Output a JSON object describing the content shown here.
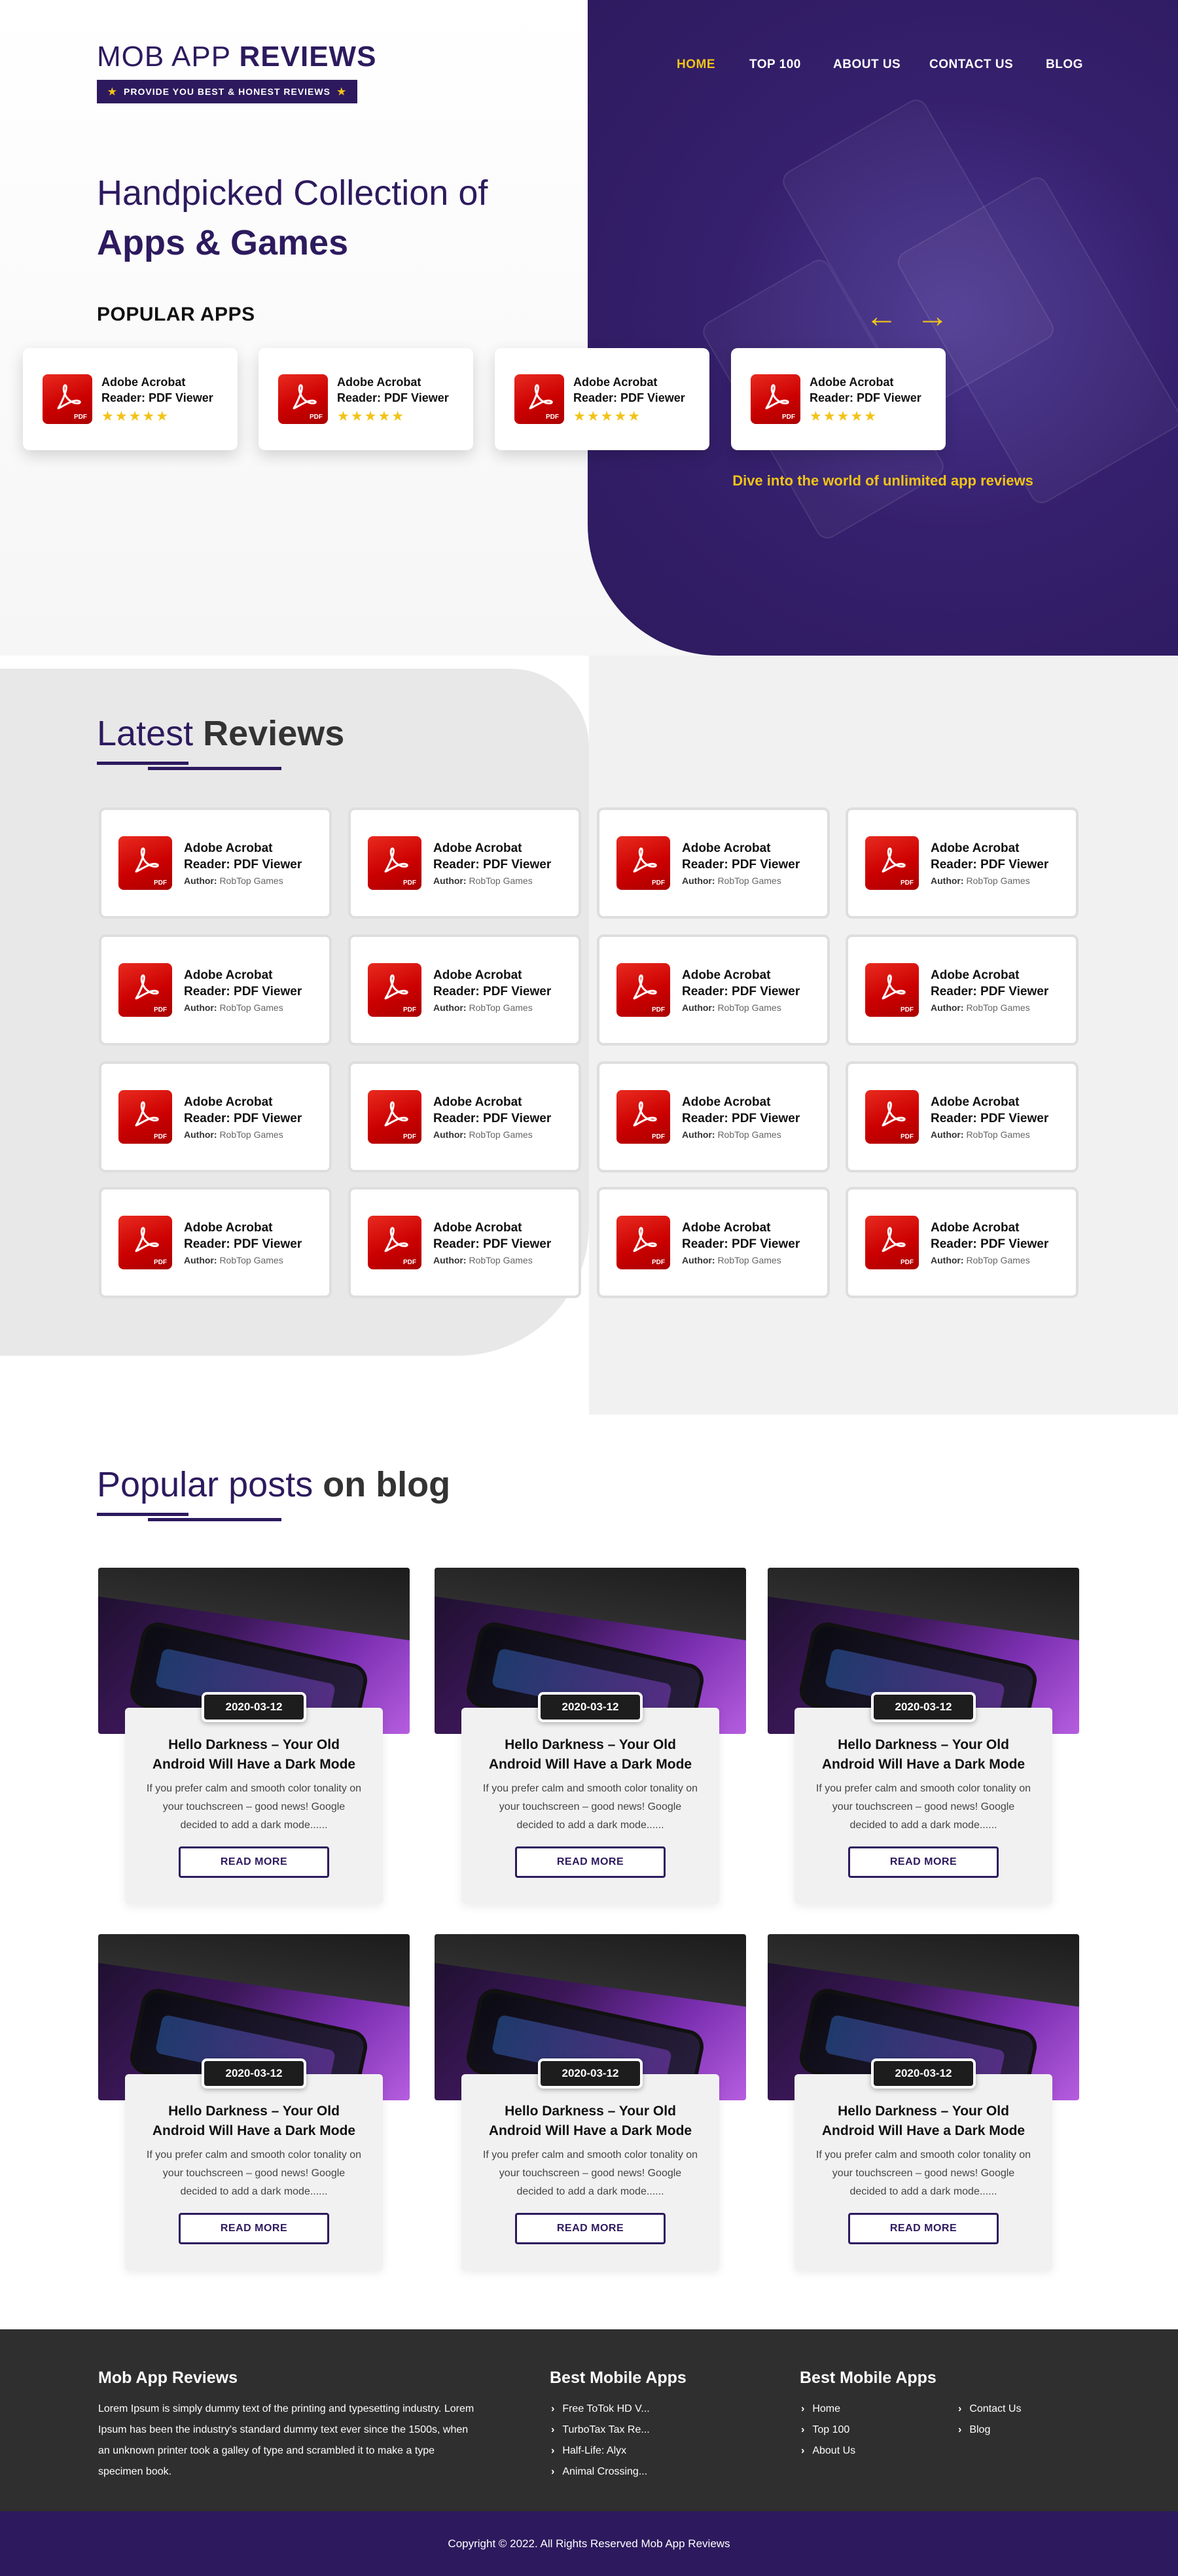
{
  "brand": {
    "title_light": "MOB APP",
    "title_bold": "REVIEWS",
    "tagline": "PROVIDE YOU BEST & HONEST REVIEWS"
  },
  "nav": [
    {
      "label": "HOME",
      "active": true
    },
    {
      "label": "TOP 100",
      "active": false
    },
    {
      "label": "ABOUT US",
      "active": false
    },
    {
      "label": "CONTACT US",
      "active": false
    },
    {
      "label": "BLOG",
      "active": false
    }
  ],
  "hero": {
    "line1": "Handpicked Collection of",
    "line2": "Apps & Games",
    "popular_title": "POPULAR APPS",
    "tagline": "Dive into the world of unlimited app reviews",
    "popular_apps": [
      {
        "name": "Adobe Acrobat Reader: PDF Viewer",
        "rating": 5
      },
      {
        "name": "Adobe Acrobat Reader: PDF Viewer",
        "rating": 5
      },
      {
        "name": "Adobe Acrobat Reader: PDF Viewer",
        "rating": 5
      },
      {
        "name": "Adobe Acrobat Reader: PDF Viewer",
        "rating": 5
      }
    ],
    "stars": "★★★★★",
    "prev_icon": "arrow-left-icon",
    "next_icon": "arrow-right-icon"
  },
  "reviews": {
    "title_light": "Latest",
    "title_bold": "Reviews",
    "author_label": "Author:",
    "items": [
      {
        "name": "Adobe Acrobat Reader: PDF Viewer",
        "author": "RobTop Games"
      },
      {
        "name": "Adobe Acrobat Reader: PDF Viewer",
        "author": "RobTop Games"
      },
      {
        "name": "Adobe Acrobat Reader: PDF Viewer",
        "author": "RobTop Games"
      },
      {
        "name": "Adobe Acrobat Reader: PDF Viewer",
        "author": "RobTop Games"
      },
      {
        "name": "Adobe Acrobat Reader: PDF Viewer",
        "author": "RobTop Games"
      },
      {
        "name": "Adobe Acrobat Reader: PDF Viewer",
        "author": "RobTop Games"
      },
      {
        "name": "Adobe Acrobat Reader: PDF Viewer",
        "author": "RobTop Games"
      },
      {
        "name": "Adobe Acrobat Reader: PDF Viewer",
        "author": "RobTop Games"
      },
      {
        "name": "Adobe Acrobat Reader: PDF Viewer",
        "author": "RobTop Games"
      },
      {
        "name": "Adobe Acrobat Reader: PDF Viewer",
        "author": "RobTop Games"
      },
      {
        "name": "Adobe Acrobat Reader: PDF Viewer",
        "author": "RobTop Games"
      },
      {
        "name": "Adobe Acrobat Reader: PDF Viewer",
        "author": "RobTop Games"
      },
      {
        "name": "Adobe Acrobat Reader: PDF Viewer",
        "author": "RobTop Games"
      },
      {
        "name": "Adobe Acrobat Reader: PDF Viewer",
        "author": "RobTop Games"
      },
      {
        "name": "Adobe Acrobat Reader: PDF Viewer",
        "author": "RobTop Games"
      },
      {
        "name": "Adobe Acrobat Reader: PDF Viewer",
        "author": "RobTop Games"
      }
    ]
  },
  "blog": {
    "title_light": "Popular posts",
    "title_bold": "on blog",
    "posts": [
      {
        "date": "2020-03-12",
        "title": "Hello Darkness – Your Old Android Will Have a Dark Mode",
        "excerpt": "If you prefer calm and smooth color tonality on your touchscreen – good news! Google decided to add a dark mode......",
        "button": "READ MORE"
      },
      {
        "date": "2020-03-12",
        "title": "Hello Darkness – Your Old Android Will Have a Dark Mode",
        "excerpt": "If you prefer calm and smooth color tonality on your touchscreen – good news! Google decided to add a dark mode......",
        "button": "READ MORE"
      },
      {
        "date": "2020-03-12",
        "title": "Hello Darkness – Your Old Android Will Have a Dark Mode",
        "excerpt": "If you prefer calm and smooth color tonality on your touchscreen – good news! Google decided to add a dark mode......",
        "button": "READ MORE"
      },
      {
        "date": "2020-03-12",
        "title": "Hello Darkness – Your Old Android Will Have a Dark Mode",
        "excerpt": "If you prefer calm and smooth color tonality on your touchscreen – good news! Google decided to add a dark mode......",
        "button": "READ MORE"
      },
      {
        "date": "2020-03-12",
        "title": "Hello Darkness – Your Old Android Will Have a Dark Mode",
        "excerpt": "If you prefer calm and smooth color tonality on your touchscreen – good news! Google decided to add a dark mode......",
        "button": "READ MORE"
      },
      {
        "date": "2020-03-12",
        "title": "Hello Darkness – Your Old Android Will Have a Dark Mode",
        "excerpt": "If you prefer calm and smooth color tonality on your touchscreen – good news! Google decided to add a dark mode......",
        "button": "READ MORE"
      }
    ]
  },
  "footer": {
    "about_title": "Mob App Reviews",
    "about_text": "Lorem Ipsum is simply dummy text of the printing and typesetting industry. Lorem Ipsum has been the industry's standard dummy text ever since the 1500s, when an unknown printer took a galley of type and scrambled it to make a type specimen book.",
    "apps_title": "Best Mobile Apps",
    "apps": [
      "Free ToTok HD V...",
      "TurboTax Tax Re...",
      "Half-Life: Alyx",
      "Animal Crossing..."
    ],
    "links_title": "Best Mobile Apps",
    "links_col1": [
      "Home",
      "Top 100",
      "About Us"
    ],
    "links_col2": [
      "Contact Us",
      "Blog"
    ],
    "copyright": "Copyright © 2022. All Rights Reserved Mob App Reviews"
  },
  "colors": {
    "brand_purple": "#2d1a5e",
    "accent_yellow": "#f2c318",
    "pdf_red": "#d40000",
    "footer_dark": "#2f2f2f"
  }
}
